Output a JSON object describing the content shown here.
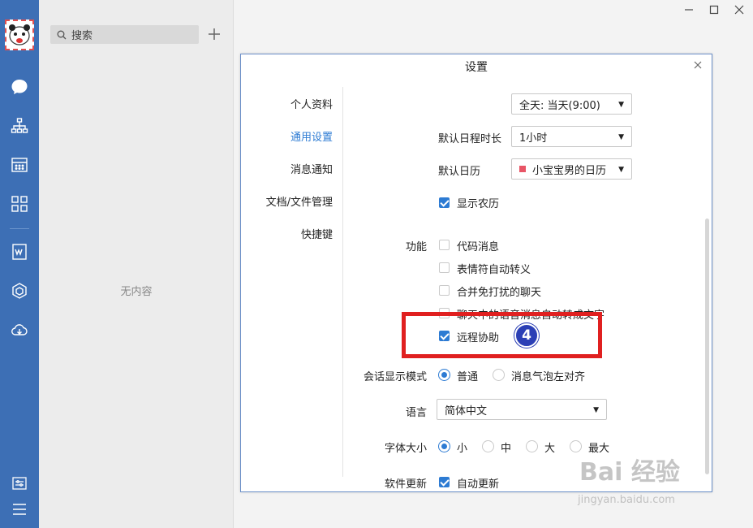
{
  "colors": {
    "rail": "#3d6fb5",
    "accent": "#2d7bd3",
    "highlight": "#e02020",
    "badge": "#2b3fb5",
    "calendar_swatch": "#e85566"
  },
  "rail": {
    "icons": [
      "chat-icon",
      "org-chart-icon",
      "calendar-icon",
      "apps-grid-icon",
      "doc-icon",
      "cube-icon",
      "cloud-icon",
      "settings-panel-icon",
      "menu-icon"
    ]
  },
  "sessions": {
    "search_placeholder": "搜索",
    "empty_text": "无内容"
  },
  "dialog": {
    "title": "设置",
    "nav": [
      "个人资料",
      "通用设置",
      "消息通知",
      "文档/文件管理",
      "快捷键"
    ],
    "active_nav": "通用设置",
    "schedule_scope": "全天: 当天(9:00)",
    "default_duration_label": "默认日程时长",
    "default_duration_value": "1小时",
    "default_calendar_label": "默认日历",
    "default_calendar_value": "小宝宝男的日历",
    "show_lunar_label": "显示农历",
    "show_lunar_checked": true,
    "features_label": "功能",
    "features": [
      {
        "label": "代码消息",
        "checked": false
      },
      {
        "label": "表情符自动转义",
        "checked": false
      },
      {
        "label": "合并免打扰的聊天",
        "checked": false
      },
      {
        "label": "聊天中的语音消息自动转成文字",
        "checked": false
      },
      {
        "label": "远程协助",
        "checked": true
      }
    ],
    "display_mode_label": "会话显示模式",
    "display_mode_options": [
      "普通",
      "消息气泡左对齐"
    ],
    "display_mode_selected": "普通",
    "language_label": "语言",
    "language_value": "简体中文",
    "font_size_label": "字体大小",
    "font_size_options": [
      "小",
      "中",
      "大",
      "最大"
    ],
    "font_size_selected": "小",
    "update_label": "软件更新",
    "auto_update_label": "自动更新",
    "auto_update_checked": true
  },
  "annotation": {
    "step": "4"
  },
  "watermark": {
    "brand": "Bai 经验",
    "url": "jingyan.baidu.com"
  }
}
